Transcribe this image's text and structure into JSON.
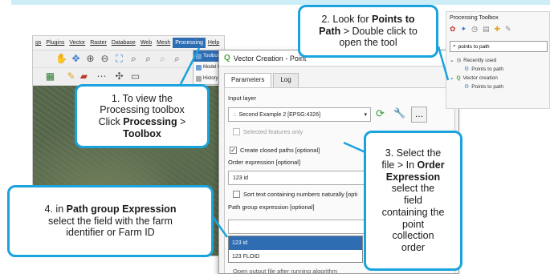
{
  "qgis": {
    "menus": [
      "gs",
      "Plugins",
      "Vector",
      "Raster",
      "Database",
      "Web",
      "Mesh",
      "Processing",
      "Help"
    ],
    "processing_menu": [
      "Toolbox",
      "Model D",
      "History"
    ]
  },
  "dialog": {
    "title": "Vector Creation - Point",
    "tabs": [
      "Parameters",
      "Log"
    ],
    "input_layer_label": "Input layer",
    "input_layer_value": "Second Example 2 [EPSG:4326]",
    "selected_only": "Selected features only",
    "closed_paths": "Create closed paths [optional]",
    "order_expression_label": "Order expression [optional]",
    "order_expression_value": "123 id",
    "sort_naturally": "Sort text containing numbers naturally [opti",
    "path_group_label": "Path group expression [optional]",
    "field_options": [
      "123 id",
      "123 FLOID"
    ],
    "bottom_text": "Open output file after running algorithm"
  },
  "toolbox": {
    "title": "Processing Toolbox",
    "search": "points to path",
    "tree": [
      {
        "label": "Recently used"
      },
      {
        "label": "Points to path"
      },
      {
        "label": "Vector creation"
      },
      {
        "label": "Points to path"
      }
    ]
  },
  "callouts": {
    "c1": {
      "line1": "1. To view the",
      "line2": "Processing toolbox",
      "line3_pre": "Click ",
      "line3_bold": "Processing",
      "line3_post": " >",
      "line4_bold": "Toolbox"
    },
    "c2": {
      "line1_pre": "2. Look for ",
      "line1_bold": "Points to",
      "line2_bold": "Path",
      "line2_post": " > Double click to",
      "line3": "open the tool"
    },
    "c3": {
      "line1": "3. Select the",
      "line2_pre": "file > In ",
      "line2_bold": "Order",
      "line3_bold": "Expression",
      "line4": "select the",
      "line5": "field",
      "line6": "containing the",
      "line7": "point",
      "line8": "collection",
      "line9": "order"
    },
    "c4": {
      "line1_pre": "4. in ",
      "line1_bold": "Path group Expression",
      "line2": "select the field with the farm",
      "line3": "identifier or Farm ID"
    }
  },
  "colors": {
    "callout_border": "#1aa3dd",
    "highlight": "#2f6db3"
  }
}
